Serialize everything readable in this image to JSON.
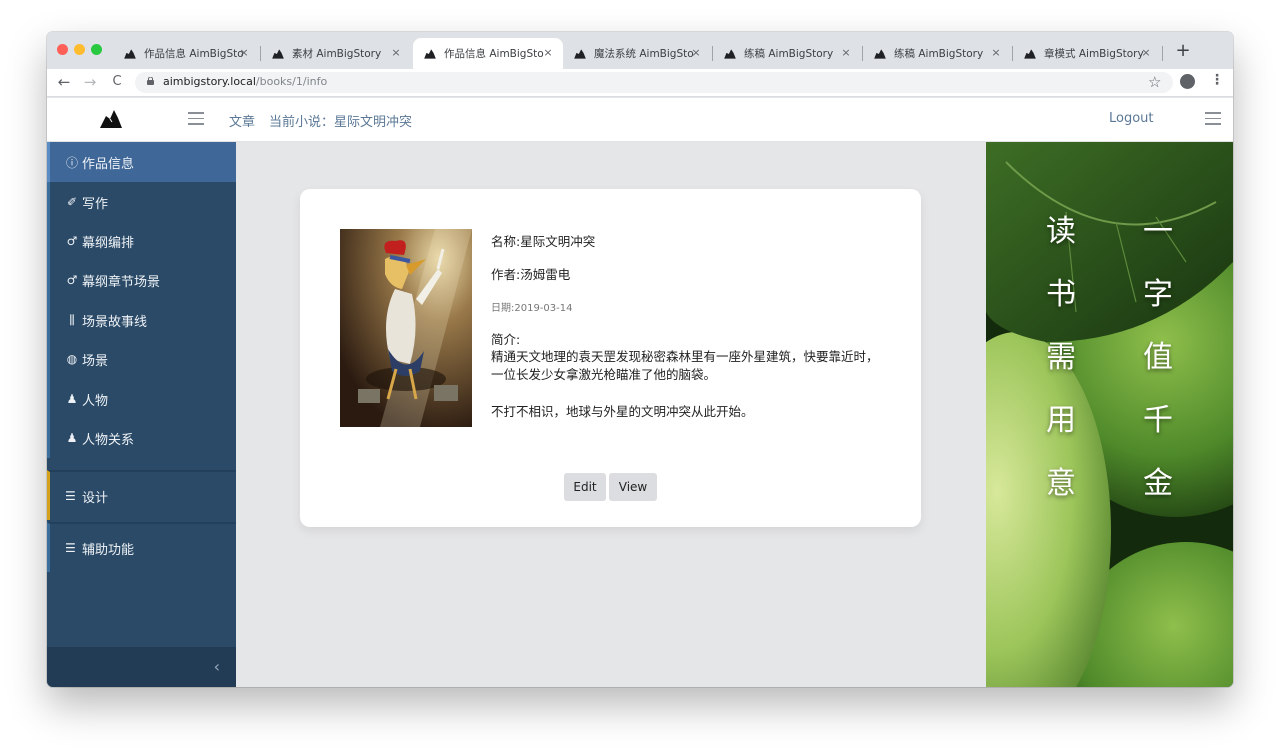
{
  "browser": {
    "tabs": [
      {
        "title": "作品信息 AimBigStory",
        "active": false
      },
      {
        "title": "素材 AimBigStory",
        "active": false
      },
      {
        "title": "作品信息 AimBigStory",
        "active": true
      },
      {
        "title": "魔法系统 AimBigStory",
        "active": false
      },
      {
        "title": "练稿 AimBigStory",
        "active": false
      },
      {
        "title": "练稿 AimBigStory",
        "active": false
      },
      {
        "title": "章模式 AimBigStory",
        "active": false
      }
    ],
    "close_glyph": "×",
    "new_tab_glyph": "+",
    "url_host": "aimbigstory.local",
    "url_path": "/books/1/info",
    "nav_back": "←",
    "nav_forward": "→",
    "nav_reload": "C",
    "star_glyph": "☆",
    "kebab_glyph": "⋮"
  },
  "header": {
    "nav_link": "文章",
    "current_novel": "当前小说：星际文明冲突",
    "logout": "Logout"
  },
  "sidebar": {
    "items": [
      {
        "label": "作品信息",
        "icon": "info-icon",
        "glyph": "ⓘ"
      },
      {
        "label": "写作",
        "icon": "pencil-icon",
        "glyph": "✐"
      },
      {
        "label": "幕纲编排",
        "icon": "link-icon",
        "glyph": "♂"
      },
      {
        "label": "幕纲章节场景",
        "icon": "link-icon",
        "glyph": "♂"
      },
      {
        "label": "场景故事线",
        "icon": "sliders-icon",
        "glyph": "⫼"
      },
      {
        "label": "场景",
        "icon": "globe-icon",
        "glyph": "◍"
      },
      {
        "label": "人物",
        "icon": "user-icon",
        "glyph": "♟"
      },
      {
        "label": "人物关系",
        "icon": "users-icon",
        "glyph": "♟"
      }
    ],
    "groups": [
      {
        "label": "设计",
        "icon": "list-icon",
        "glyph": "☰"
      },
      {
        "label": "辅助功能",
        "icon": "list-icon",
        "glyph": "☰"
      }
    ],
    "collapse_glyph": "‹"
  },
  "book": {
    "name": "名称:星际文明冲突",
    "author": "作者:汤姆雷电",
    "date": "日期:2019-03-14",
    "intro_label": "简介:",
    "intro": "精通天文地理的袁天罡发现秘密森林里有一座外星建筑，快要靠近时，一位长发少女拿激光枪瞄准了他的脑袋。",
    "intro2": "不打不相识，地球与外星的文明冲突从此开始。",
    "cover_alt": "rooster singing under spotlight"
  },
  "buttons": {
    "edit": "Edit",
    "view": "View"
  },
  "banner": {
    "left_column": [
      "读",
      "书",
      "需",
      "用",
      "意"
    ],
    "right_column": [
      "一",
      "字",
      "值",
      "千",
      "金"
    ]
  },
  "colors": {
    "sidebar_bg": "#2b4a67",
    "sidebar_active": "#3f6797",
    "group_accent_design": "#d6a21e",
    "link_color": "#5b7896"
  }
}
